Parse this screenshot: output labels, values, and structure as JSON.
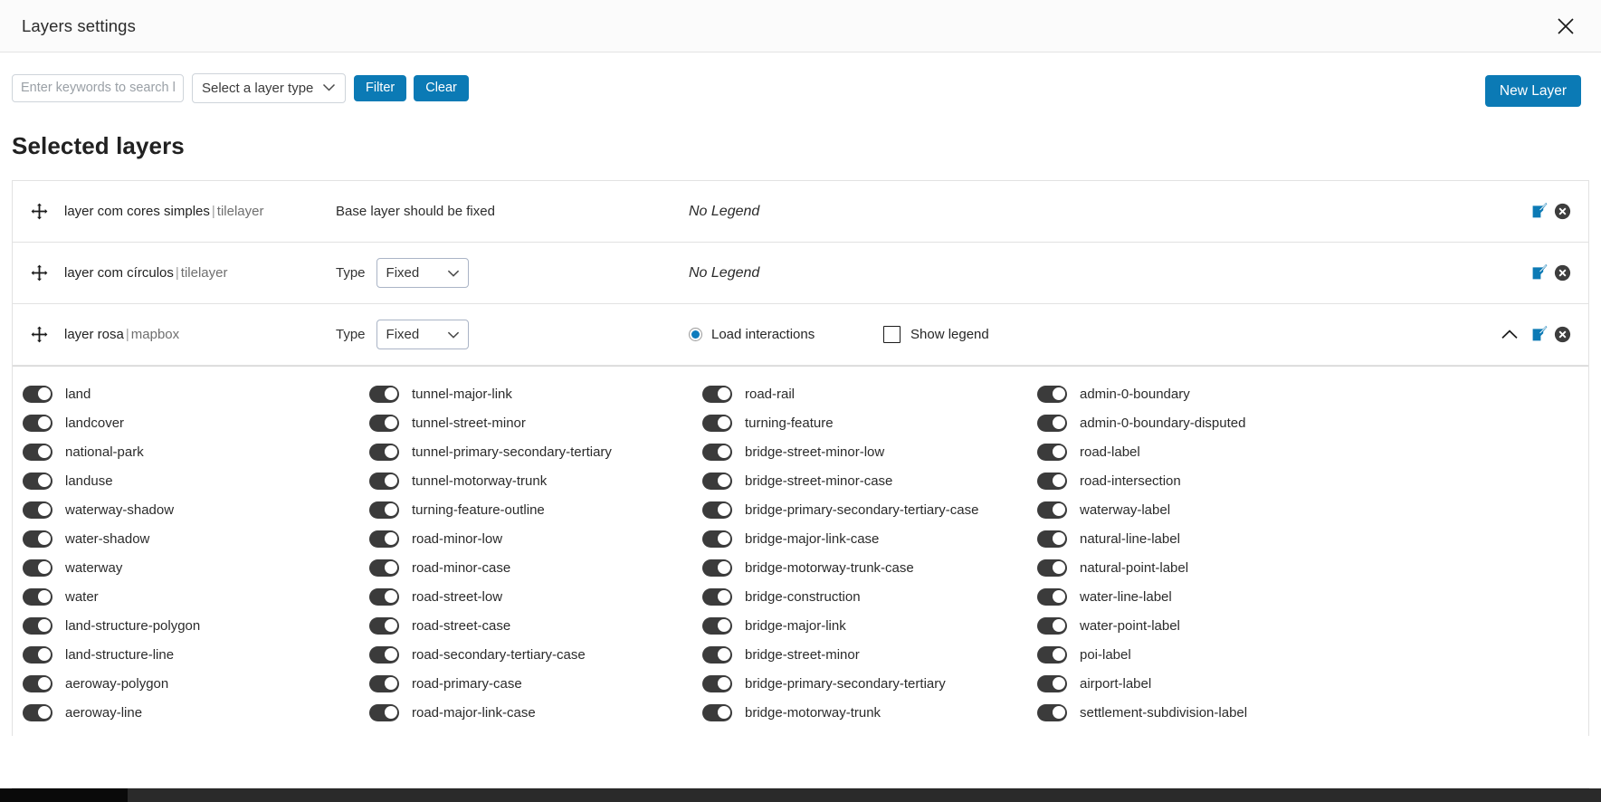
{
  "header": {
    "title": "Layers settings",
    "close_icon": "close-icon"
  },
  "filter_bar": {
    "search_placeholder": "Enter keywords to search la",
    "search_value": "",
    "layer_type_selected": "Select a layer type",
    "layer_type_options": [
      "Select a layer type"
    ],
    "filter_label": "Filter",
    "clear_label": "Clear",
    "new_layer_label": "New Layer"
  },
  "section": {
    "title": "Selected layers"
  },
  "colors": {
    "accent": "#0b7ab5",
    "radio_fill": "#0d7bbd",
    "toggle_on": "#3b3b3b",
    "edit_icon": "#0c7ab5",
    "delete_icon": "#3d3d3d"
  },
  "labels": {
    "type": "Type",
    "no_legend": "No Legend",
    "base_layer_fixed": "Base layer should be fixed",
    "load_interactions": "Load interactions",
    "show_legend": "Show legend"
  },
  "layers": [
    {
      "name": "layer com cores simples",
      "separator": "|",
      "kind": "tilelayer",
      "type_mode": "note",
      "type_note": "Base layer should be fixed",
      "legend_text": "No Legend",
      "expanded": false,
      "has_interactions": false
    },
    {
      "name": "layer com círculos",
      "separator": "|",
      "kind": "tilelayer",
      "type_mode": "select",
      "type_value": "Fixed",
      "type_options": [
        "Fixed"
      ],
      "legend_text": "No Legend",
      "expanded": false,
      "has_interactions": false
    },
    {
      "name": "layer rosa",
      "separator": "|",
      "kind": "mapbox",
      "type_mode": "select",
      "type_value": "Fixed",
      "type_options": [
        "Fixed"
      ],
      "load_interactions_label": "Load interactions",
      "load_interactions_checked": true,
      "show_legend_label": "Show legend",
      "show_legend_checked": false,
      "expanded": true,
      "has_interactions": true
    }
  ],
  "sublayers": {
    "column_1": [
      "land",
      "landcover",
      "national-park",
      "landuse",
      "waterway-shadow",
      "water-shadow",
      "waterway",
      "water",
      "land-structure-polygon",
      "land-structure-line",
      "aeroway-polygon",
      "aeroway-line"
    ],
    "column_2": [
      "tunnel-major-link",
      "tunnel-street-minor",
      "tunnel-primary-secondary-tertiary",
      "tunnel-motorway-trunk",
      "turning-feature-outline",
      "road-minor-low",
      "road-minor-case",
      "road-street-low",
      "road-street-case",
      "road-secondary-tertiary-case",
      "road-primary-case",
      "road-major-link-case"
    ],
    "column_3": [
      "road-rail",
      "turning-feature",
      "bridge-street-minor-low",
      "bridge-street-minor-case",
      "bridge-primary-secondary-tertiary-case",
      "bridge-major-link-case",
      "bridge-motorway-trunk-case",
      "bridge-construction",
      "bridge-major-link",
      "bridge-street-minor",
      "bridge-primary-secondary-tertiary",
      "bridge-motorway-trunk"
    ],
    "column_4": [
      "admin-0-boundary",
      "admin-0-boundary-disputed",
      "road-label",
      "road-intersection",
      "waterway-label",
      "natural-line-label",
      "natural-point-label",
      "water-line-label",
      "water-point-label",
      "poi-label",
      "airport-label",
      "settlement-subdivision-label"
    ],
    "all_enabled": true
  }
}
